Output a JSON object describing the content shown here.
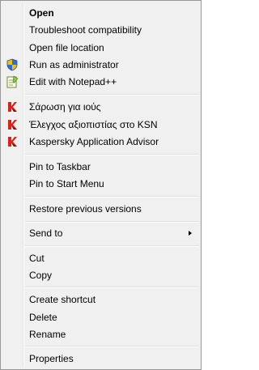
{
  "context_menu": {
    "items": [
      {
        "id": "open",
        "label": "Open",
        "bold": true
      },
      {
        "id": "troubleshoot",
        "label": "Troubleshoot compatibility"
      },
      {
        "id": "open-location",
        "label": "Open file location"
      },
      {
        "id": "run-admin",
        "label": "Run as administrator",
        "icon": "uac-shield-icon"
      },
      {
        "id": "notepadpp",
        "label": "Edit with Notepad++",
        "icon": "notepad-plus-plus-icon"
      },
      {
        "id": "scan-virus",
        "label": "Σάρωση για ιούς",
        "icon": "kaspersky-icon"
      },
      {
        "id": "ksn-check",
        "label": "Έλεγχος αξιοπιστίας στο KSN",
        "icon": "kaspersky-icon"
      },
      {
        "id": "kaspersky-advisor",
        "label": "Kaspersky Application Advisor",
        "icon": "kaspersky-icon"
      },
      {
        "id": "pin-taskbar",
        "label": "Pin to Taskbar"
      },
      {
        "id": "pin-start",
        "label": "Pin to Start Menu"
      },
      {
        "id": "restore",
        "label": "Restore previous versions"
      },
      {
        "id": "send-to",
        "label": "Send to",
        "submenu": true
      },
      {
        "id": "cut",
        "label": "Cut"
      },
      {
        "id": "copy",
        "label": "Copy"
      },
      {
        "id": "create-shortcut",
        "label": "Create shortcut"
      },
      {
        "id": "delete",
        "label": "Delete"
      },
      {
        "id": "rename",
        "label": "Rename"
      },
      {
        "id": "properties",
        "label": "Properties"
      }
    ]
  },
  "colors": {
    "menu_background": "#f0f0f0",
    "menu_border": "#979797",
    "separator": "#e0e0e0",
    "kaspersky_red": "#d9211d"
  }
}
